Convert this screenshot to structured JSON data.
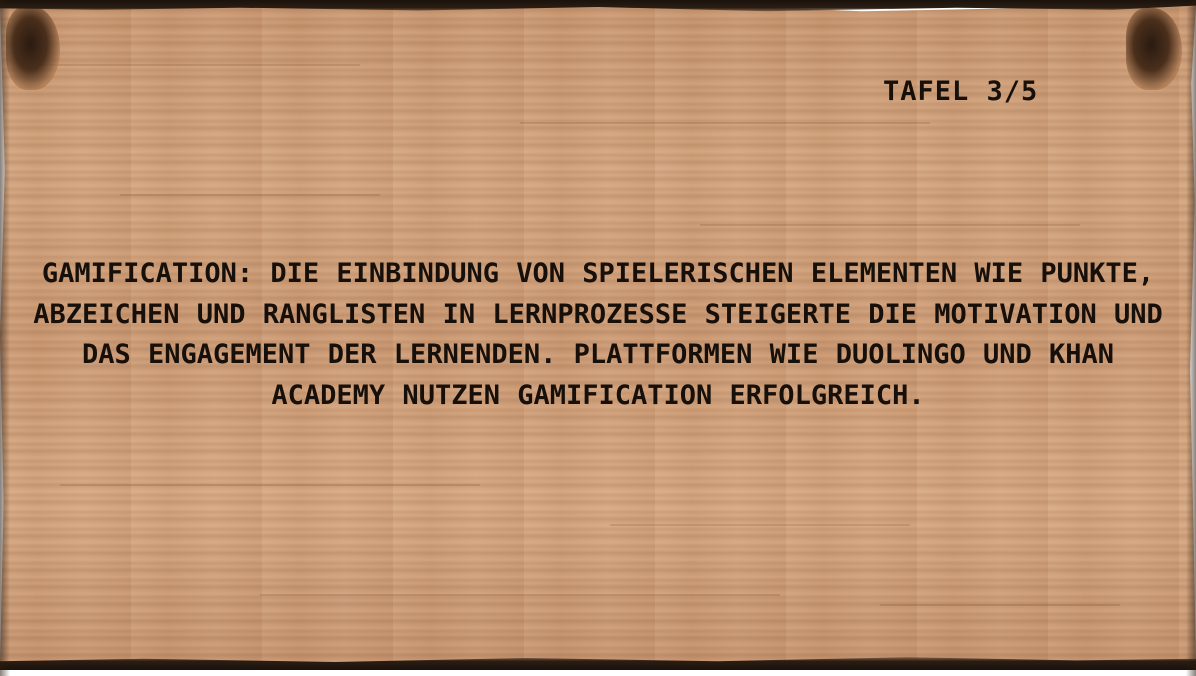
{
  "board": {
    "page_indicator": "TAFEL 3/5",
    "text": "GAMIFICATION: DIE EINBINDUNG VON SPIELERISCHEN ELEMENTEN WIE PUNKTE, ABZEICHEN UND RANGLISTEN IN LERNPROZESSE STEIGERTE DIE MOTIVATION UND DAS ENGAGEMENT DER LERNENDEN. PLATTFORMEN WIE DUOLINGO UND KHAN ACADEMY NUTZEN GAMIFICATION ERFOLGREICH."
  },
  "colors": {
    "wood": "#cf9f7a",
    "text": "#17100a",
    "edge": "#1a120c"
  }
}
